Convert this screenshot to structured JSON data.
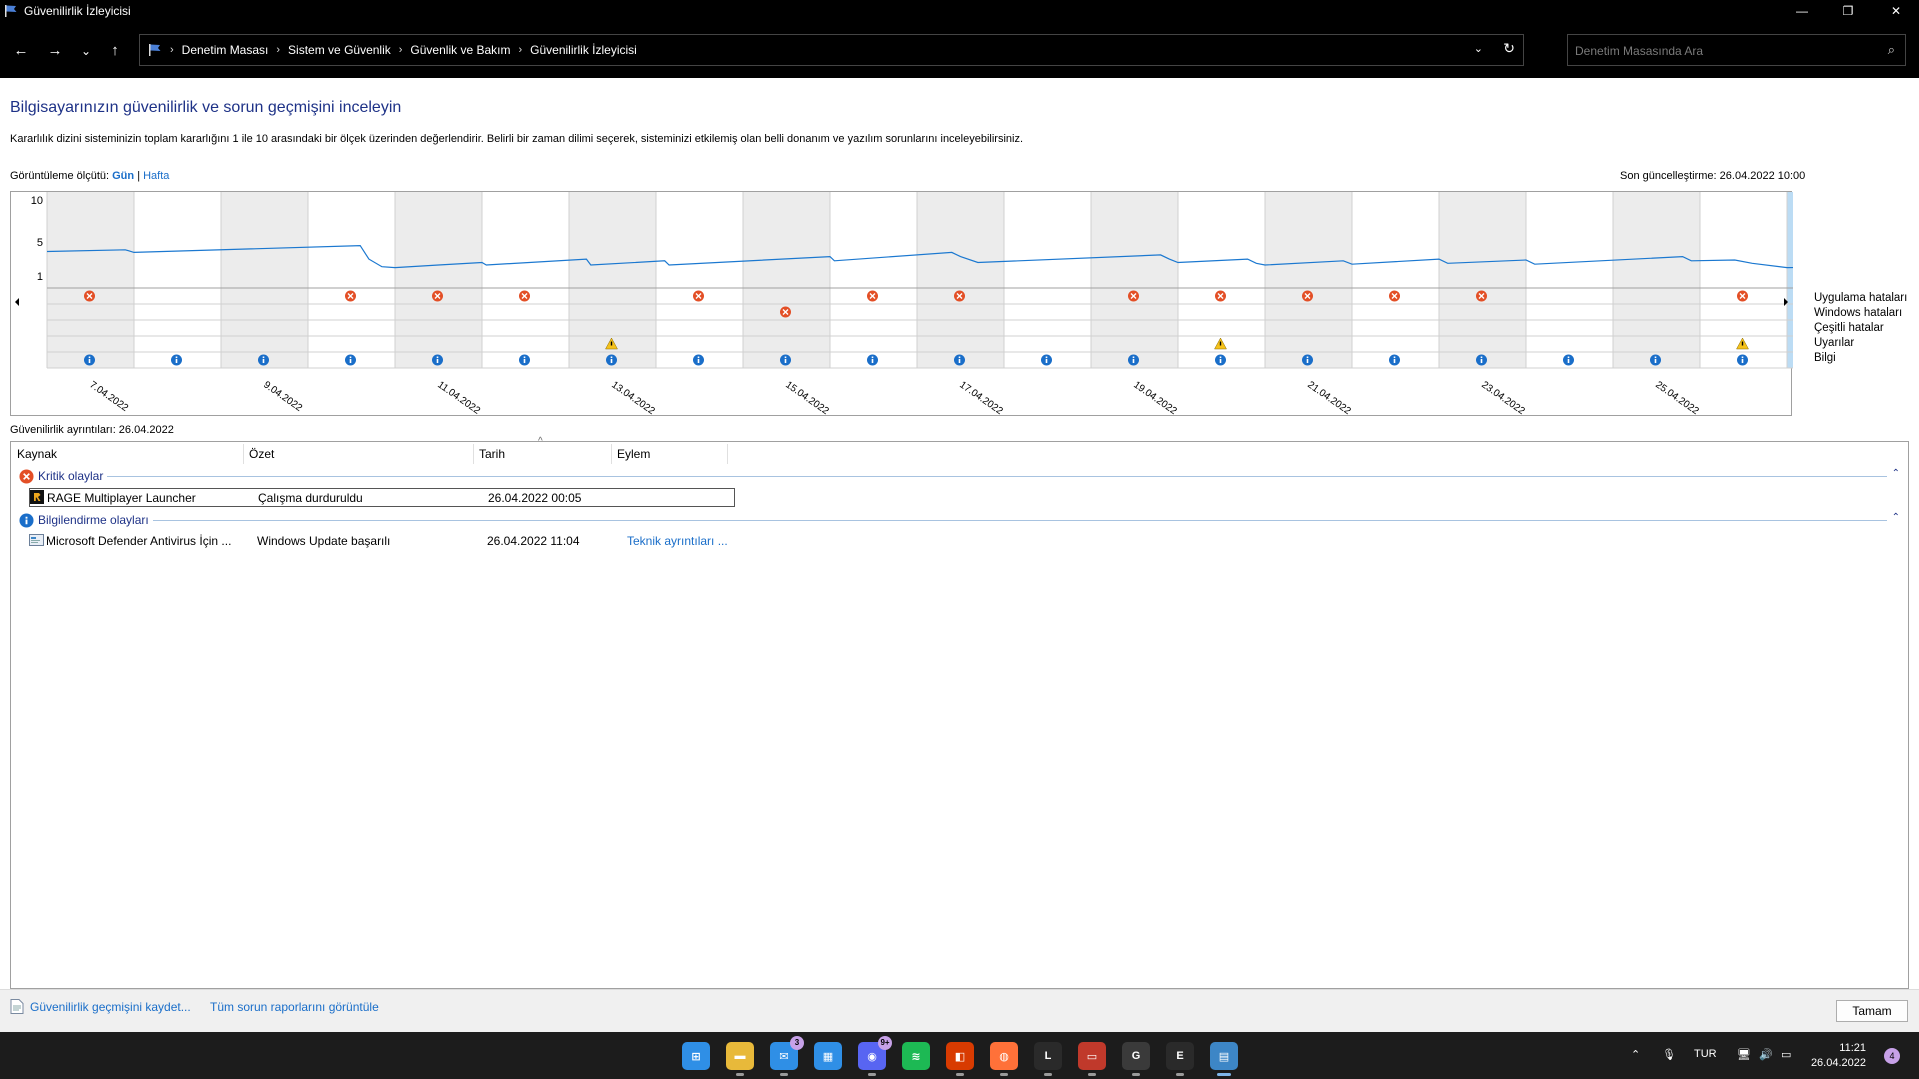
{
  "window": {
    "title": "Güvenilirlik İzleyicisi",
    "minimize": "—",
    "maximize": "❐",
    "close": "✕"
  },
  "nav": {
    "back": "←",
    "forward": "→",
    "recent": "⌄",
    "up": "↑",
    "breadcrumbs": [
      "Denetim Masası",
      "Sistem ve Güvenlik",
      "Güvenlik ve Bakım",
      "Güvenilirlik İzleyicisi"
    ],
    "search_placeholder": "Denetim Masasında Ara"
  },
  "main": {
    "heading": "Bilgisayarınızın güvenilirlik ve sorun geçmişini inceleyin",
    "description": "Kararlılık dizini sisteminizin toplam kararlığını 1 ile 10 arasındaki bir ölçek üzerinden değerlendirir. Belirli bir zaman dilimi seçerek, sisteminizi etkilemiş olan belli donanım ve yazılım sorunlarını inceleyebilirsiniz.",
    "view_by_label": "Görüntüleme ölçütü:",
    "view_day": "Gün",
    "view_sep": "|",
    "view_week": "Hafta",
    "last_updated": "Son güncelleştirme: 26.04.2022 10:00"
  },
  "chart_data": {
    "type": "line",
    "title": "",
    "ylabel": "",
    "y_ticks": [
      10,
      5,
      1
    ],
    "ylim": [
      1,
      10
    ],
    "days": [
      "06.04.2022",
      "07.04.2022",
      "08.04.2022",
      "09.04.2022",
      "10.04.2022",
      "11.04.2022",
      "12.04.2022",
      "13.04.2022",
      "14.04.2022",
      "15.04.2022",
      "16.04.2022",
      "17.04.2022",
      "18.04.2022",
      "19.04.2022",
      "20.04.2022",
      "21.04.2022",
      "22.04.2022",
      "23.04.2022",
      "24.04.2022",
      "25.04.2022",
      "26.04.2022"
    ],
    "date_labels": [
      "7.04.2022",
      "9.04.2022",
      "11.04.2022",
      "13.04.2022",
      "15.04.2022",
      "17.04.2022",
      "19.04.2022",
      "21.04.2022",
      "23.04.2022",
      "25.04.2022"
    ],
    "selected_day": "26.04.2022",
    "stability_index": [
      {
        "d": 0,
        "v": 3.9
      },
      {
        "d": 0.9,
        "v": 4.1
      },
      {
        "d": 1.0,
        "v": 3.8
      },
      {
        "d": 3.6,
        "v": 4.6
      },
      {
        "d": 3.7,
        "v": 3.0
      },
      {
        "d": 3.85,
        "v": 2.1
      },
      {
        "d": 4.0,
        "v": 2.0
      },
      {
        "d": 4.5,
        "v": 2.3
      },
      {
        "d": 5.0,
        "v": 2.6
      },
      {
        "d": 5.05,
        "v": 2.3
      },
      {
        "d": 6.2,
        "v": 3.0
      },
      {
        "d": 6.25,
        "v": 2.3
      },
      {
        "d": 7.1,
        "v": 2.8
      },
      {
        "d": 7.15,
        "v": 2.3
      },
      {
        "d": 9.0,
        "v": 3.3
      },
      {
        "d": 9.05,
        "v": 2.8
      },
      {
        "d": 10.4,
        "v": 3.8
      },
      {
        "d": 10.5,
        "v": 3.3
      },
      {
        "d": 10.7,
        "v": 2.6
      },
      {
        "d": 12.8,
        "v": 3.5
      },
      {
        "d": 12.9,
        "v": 3.0
      },
      {
        "d": 13.0,
        "v": 2.6
      },
      {
        "d": 13.8,
        "v": 3.0
      },
      {
        "d": 13.9,
        "v": 2.5
      },
      {
        "d": 14.0,
        "v": 2.3
      },
      {
        "d": 14.9,
        "v": 2.8
      },
      {
        "d": 15.0,
        "v": 2.4
      },
      {
        "d": 16.0,
        "v": 3.0
      },
      {
        "d": 16.1,
        "v": 2.5
      },
      {
        "d": 17.0,
        "v": 2.9
      },
      {
        "d": 17.1,
        "v": 2.4
      },
      {
        "d": 18.8,
        "v": 3.3
      },
      {
        "d": 18.9,
        "v": 2.8
      },
      {
        "d": 19.4,
        "v": 2.9
      },
      {
        "d": 19.6,
        "v": 2.5
      },
      {
        "d": 20.0,
        "v": 2.0
      },
      {
        "d": 21.0,
        "v": 2.2
      }
    ],
    "rows": [
      "Uygulama hataları",
      "Windows hataları",
      "Çeşitli hatalar",
      "Uyarılar",
      "Bilgi"
    ],
    "app_failure_days": [
      0,
      3,
      4,
      5,
      7,
      9,
      10,
      12,
      13,
      14,
      15,
      16,
      19,
      20
    ],
    "windows_failure_days": [
      8
    ],
    "misc_failure_days": [],
    "warning_days": [
      6,
      13,
      19
    ],
    "info_days": [
      0,
      1,
      2,
      3,
      4,
      5,
      6,
      7,
      8,
      9,
      10,
      11,
      12,
      13,
      14,
      15,
      16,
      17,
      18,
      19,
      20
    ]
  },
  "details": {
    "title": "Güvenilirlik ayrıntıları: 26.04.2022",
    "columns": [
      "Kaynak",
      "Özet",
      "Tarih",
      "Eylem"
    ],
    "sort_indicator": "^",
    "groups": [
      {
        "label": "Kritik olaylar",
        "icon": "error-icon",
        "collapse": "⌃",
        "events": [
          {
            "source": "RAGE Multiplayer Launcher",
            "summary": "Çalışma durduruldu",
            "date": "26.04.2022 00:05",
            "action": "",
            "icon": "rage-app-icon"
          }
        ]
      },
      {
        "label": "Bilgilendirme olayları",
        "icon": "info-icon",
        "collapse": "⌃",
        "events": [
          {
            "source": "Microsoft Defender Antivirus İçin ...",
            "summary": "Windows Update başarılı",
            "date": "26.04.2022 11:04",
            "action": "Teknik ayrıntıları ...",
            "icon": "update-icon"
          }
        ]
      }
    ]
  },
  "footer": {
    "save_history": "Güvenilirlik geçmişini kaydet...",
    "view_reports": "Tüm sorun raporlarını görüntüle",
    "ok": "Tamam"
  },
  "taskbar": {
    "apps": [
      {
        "name": "start-icon",
        "color": "#2f8fe6",
        "glyph": "⊞"
      },
      {
        "name": "file-explorer-icon",
        "color": "#e8b93a",
        "glyph": "▬"
      },
      {
        "name": "mail-icon",
        "color": "#2f8fe6",
        "glyph": "✉",
        "badge": "3"
      },
      {
        "name": "calendar-icon",
        "color": "#2f8fe6",
        "glyph": "▦"
      },
      {
        "name": "discord-icon",
        "color": "#5865f2",
        "glyph": "◉",
        "badge": "9+"
      },
      {
        "name": "spotify-icon",
        "color": "#1db954",
        "glyph": "≋"
      },
      {
        "name": "office-icon",
        "color": "#d83b01",
        "glyph": "◧"
      },
      {
        "name": "firefox-icon",
        "color": "#ff7139",
        "glyph": "◍"
      },
      {
        "name": "launcher-l-icon",
        "color": "#2a2a2a",
        "glyph": "L"
      },
      {
        "name": "voicemeeter-icon",
        "color": "#c0392b",
        "glyph": "▭"
      },
      {
        "name": "gog-icon",
        "color": "#3a3a3a",
        "glyph": "G"
      },
      {
        "name": "epic-games-icon",
        "color": "#2a2a2a",
        "glyph": "E"
      },
      {
        "name": "reliability-monitor-icon",
        "color": "#3d86c6",
        "glyph": "▤"
      }
    ],
    "tray": {
      "chevron": "⌃",
      "mic": "🎙",
      "lang": "TUR",
      "network": "🖥",
      "volume": "🔊",
      "battery": "▭",
      "time": "11:21",
      "date": "26.04.2022",
      "notifications": "4"
    }
  }
}
